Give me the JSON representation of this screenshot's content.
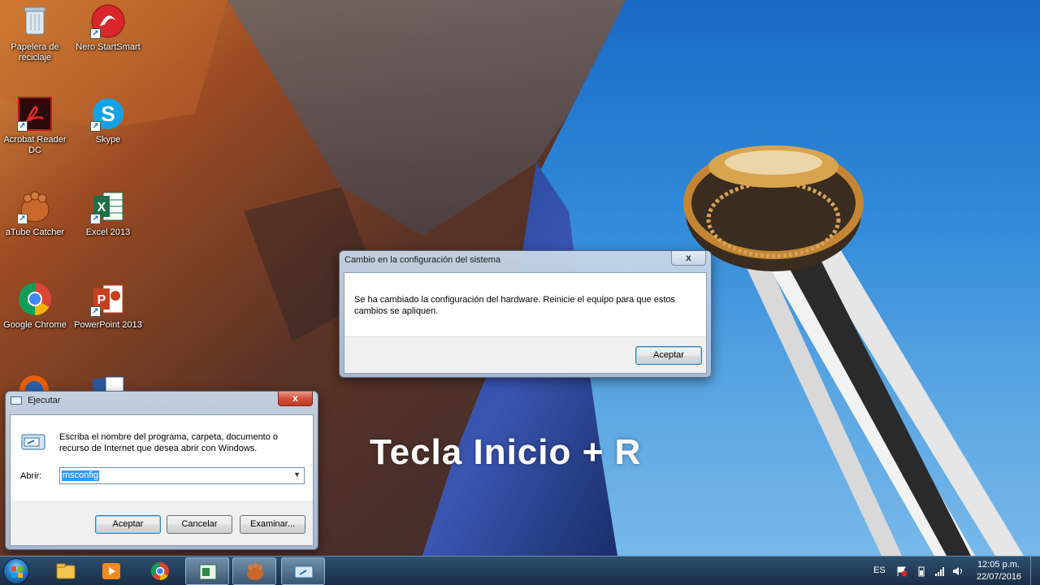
{
  "desktop": {
    "icons": [
      {
        "label": "Papelera de reciclaje"
      },
      {
        "label": "Nero StartSmart"
      },
      {
        "label": "Acrobat Reader DC"
      },
      {
        "label": "Skype"
      },
      {
        "label": "aTube Catcher"
      },
      {
        "label": "Excel 2013"
      },
      {
        "label": "Google Chrome"
      },
      {
        "label": "PowerPoint 2013"
      }
    ]
  },
  "caption": "Tecla Inicio + R",
  "system_dialog": {
    "title": "Cambio en la configuración del sistema",
    "close_label": "x",
    "message": "Se ha cambiado la configuración del hardware. Reinicie el equipo para que estos cambios se apliquen.",
    "ok_label": "Aceptar"
  },
  "run_dialog": {
    "title": "Ejecutar",
    "close_label": "x",
    "description": "Escriba el nombre del programa, carpeta, documento o recurso de Internet que desea abrir con Windows.",
    "open_label": "Abrir:",
    "input_value": "msconfig",
    "ok_label": "Aceptar",
    "cancel_label": "Cancelar",
    "browse_label": "Examinar..."
  },
  "taskbar": {
    "language": "ES",
    "time": "12:05 p.m.",
    "date": "22/07/2016"
  },
  "colors": {
    "taskbar": "#1c3550",
    "close_red": "#c13a26",
    "default_button_border": "#3c7fb1"
  }
}
